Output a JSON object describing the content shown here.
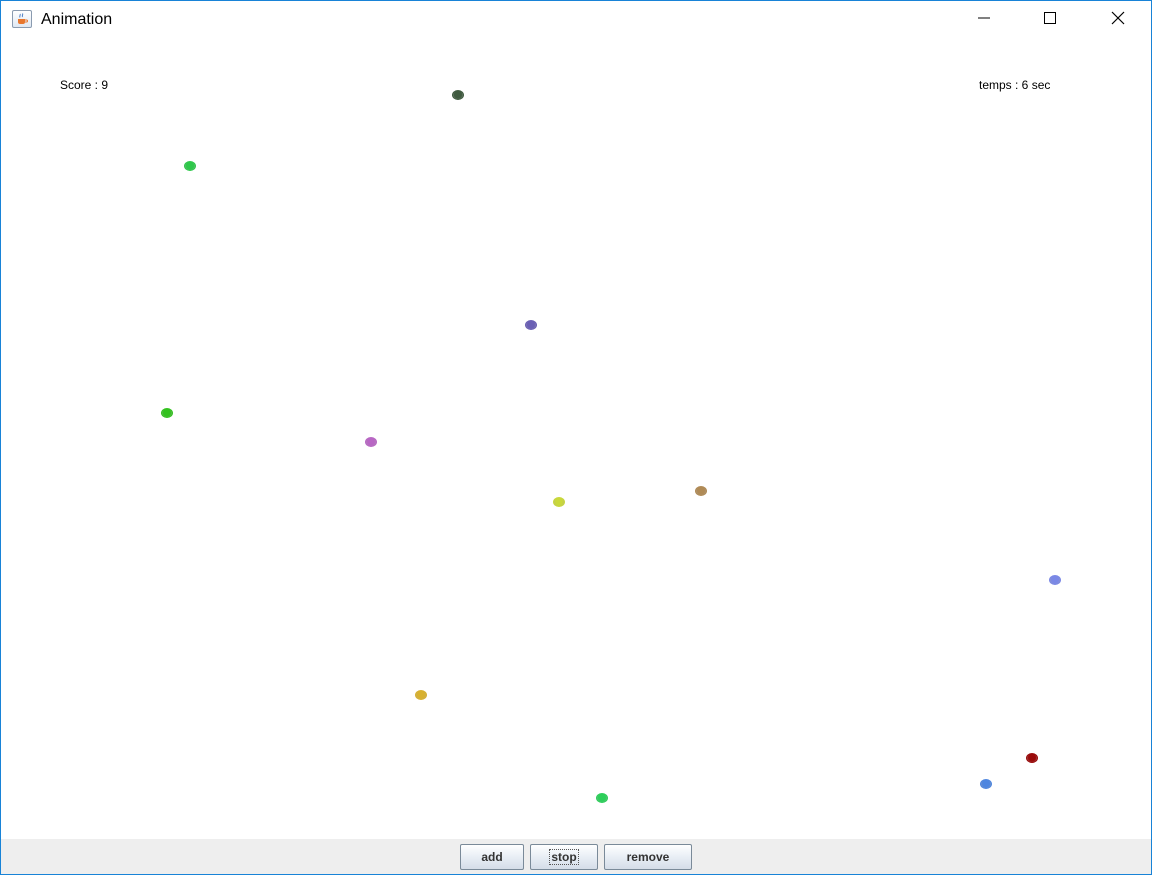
{
  "window": {
    "title": "Animation",
    "icon": "java-cup-icon",
    "controls": [
      "minimize-icon",
      "maximize-icon",
      "close-icon"
    ]
  },
  "hud": {
    "score": "Score : 9",
    "time": "temps : 6 sec"
  },
  "balls": [
    {
      "color": "#3f5a3f"
    },
    {
      "color": "#2ec84a"
    },
    {
      "color": "#6a5fb5"
    },
    {
      "color": "#33c21e"
    },
    {
      "color": "#b866c4"
    },
    {
      "color": "#c9d83a"
    },
    {
      "color": "#b08a55"
    },
    {
      "color": "#7a88e6"
    },
    {
      "color": "#d8b12e"
    },
    {
      "color": "#9a0a0a"
    },
    {
      "color": "#4e86e0"
    },
    {
      "color": "#2ccf5a"
    }
  ],
  "buttons": {
    "add": "add",
    "stop": "stop",
    "remove": "remove"
  },
  "colors": {
    "window_border": "#1883d7",
    "bottom_bar": "#eeeeee"
  }
}
